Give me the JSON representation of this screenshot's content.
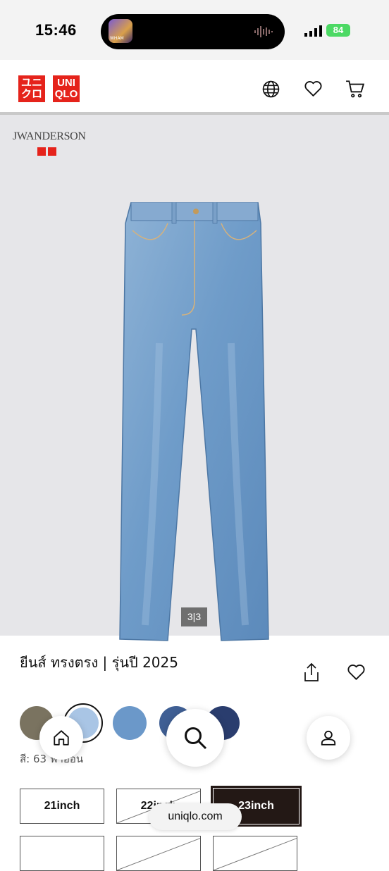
{
  "status_bar": {
    "time": "15:46",
    "battery": "84",
    "island_art_text": "WHAM"
  },
  "header": {
    "logo_top": [
      "ユニ",
      "クロ"
    ],
    "logo_bottom": [
      "UNI",
      "QLO"
    ]
  },
  "gallery": {
    "brand_text": "JWANDERSON",
    "pager": "3|3",
    "accent_color": "#e5231b"
  },
  "product": {
    "title": "ยีนส์ ทรงตรง | รุ่นปี 2025",
    "color_label": "สี: 63 ฟ้าอ่อน",
    "swatches": [
      {
        "name": "olive",
        "color": "#7a7360"
      },
      {
        "name": "light-blue",
        "color": "#a9c5e5"
      },
      {
        "name": "mid-light-blue",
        "color": "#6b98c9"
      },
      {
        "name": "blue",
        "color": "#3f5f94"
      },
      {
        "name": "dark-blue",
        "color": "#2a3d6e"
      }
    ]
  },
  "sizes": [
    {
      "label": "21inch",
      "state": "available"
    },
    {
      "label": "22inch",
      "state": "unavailable"
    },
    {
      "label": "23inch",
      "state": "selected"
    }
  ],
  "browser": {
    "url": "uniqlo.com"
  }
}
